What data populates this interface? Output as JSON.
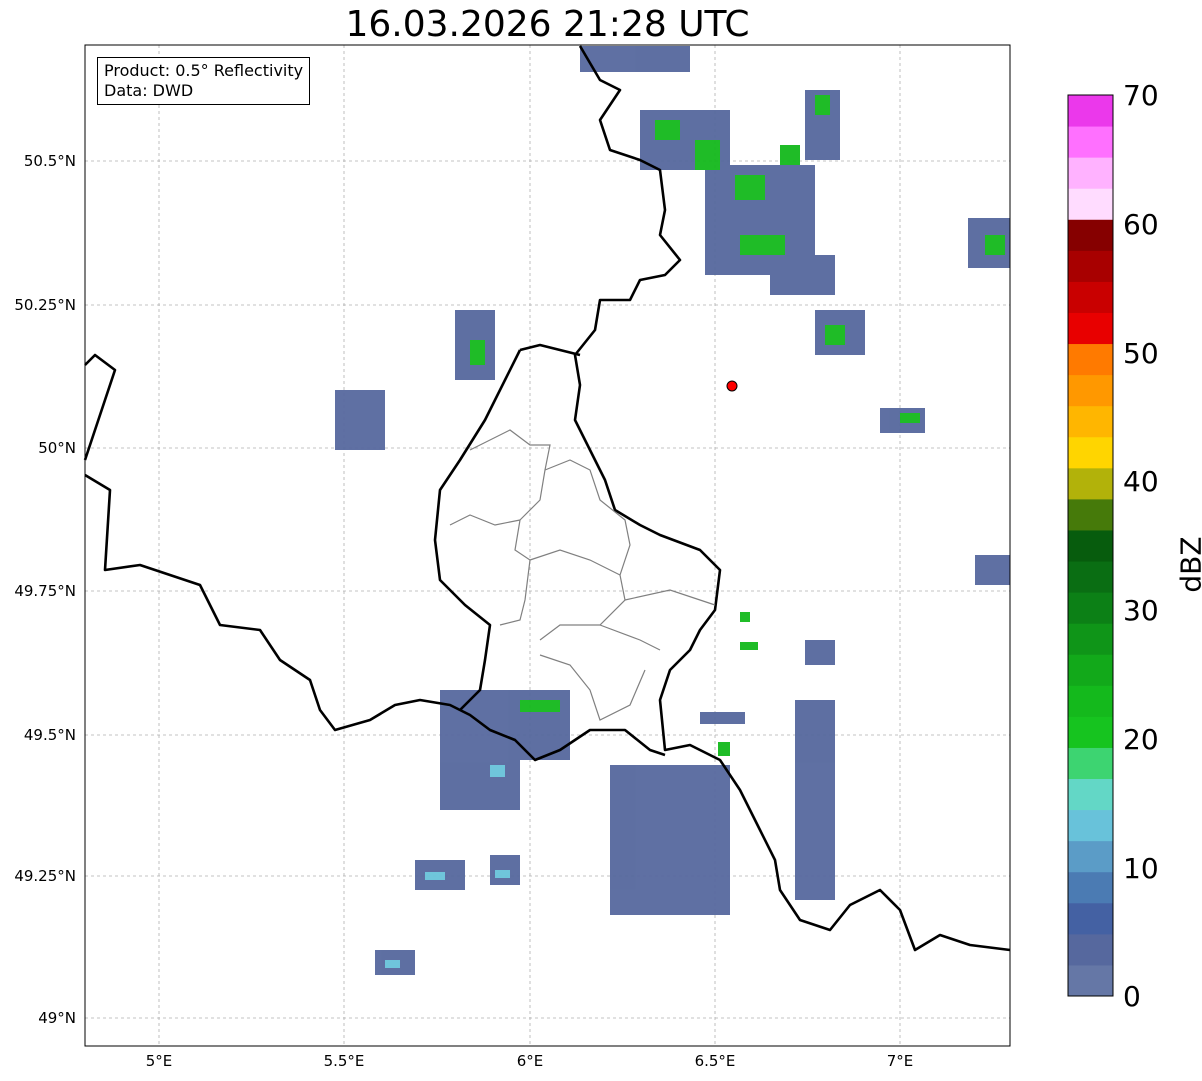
{
  "title": "16.03.2026 21:28 UTC",
  "info": {
    "product": "Product: 0.5° Reflectivity",
    "data": "Data: DWD"
  },
  "axes": {
    "x_ticks": [
      "5°E",
      "5.5°E",
      "6°E",
      "6.5°E",
      "7°E"
    ],
    "y_ticks": [
      "50.5°N",
      "50.25°N",
      "50°N",
      "49.75°N",
      "49.5°N",
      "49.25°N",
      "49°N"
    ],
    "lon_range": [
      4.8,
      7.3
    ],
    "lat_range": [
      48.95,
      50.7
    ]
  },
  "colorbar": {
    "unit": "dBZ",
    "ticks": [
      "70",
      "60",
      "50",
      "40",
      "30",
      "20",
      "10",
      "0"
    ],
    "min": 0,
    "max": 70,
    "colors": [
      "#6577a6",
      "#56689e",
      "#4461a3",
      "#4b7bb3",
      "#5b9cc7",
      "#68c2da",
      "#63d7c6",
      "#3dd471",
      "#16c41f",
      "#14b91c",
      "#12a91a",
      "#0f9518",
      "#0c8016",
      "#0a6e13",
      "#075c0d",
      "#467a0a",
      "#b2b20a",
      "#ffd500",
      "#ffb600",
      "#ff9800",
      "#ff7a00",
      "#e80000",
      "#c90000",
      "#a80000",
      "#860000",
      "#ffdcff",
      "#ffb2ff",
      "#ff70ff",
      "#eb38eb"
    ]
  },
  "radar_marker": {
    "lon": 6.55,
    "lat": 50.11,
    "color": "#ff0000"
  },
  "icons": {
    "marker": "radar-site-icon"
  }
}
